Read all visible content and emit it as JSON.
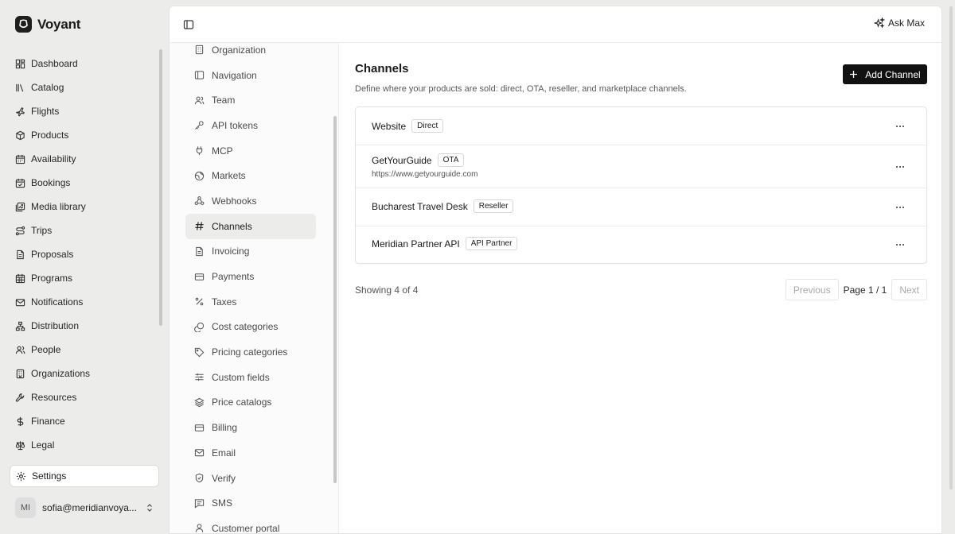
{
  "brand": {
    "name": "Voyant"
  },
  "sidebar": {
    "items": [
      {
        "label": "Dashboard",
        "icon": "dashboard-icon"
      },
      {
        "label": "Catalog",
        "icon": "catalog-icon"
      },
      {
        "label": "Flights",
        "icon": "plane-icon"
      },
      {
        "label": "Products",
        "icon": "package-icon"
      },
      {
        "label": "Availability",
        "icon": "calendar-icon"
      },
      {
        "label": "Bookings",
        "icon": "calendar-check-icon"
      },
      {
        "label": "Media library",
        "icon": "image-icon"
      },
      {
        "label": "Trips",
        "icon": "route-icon"
      },
      {
        "label": "Proposals",
        "icon": "document-icon"
      },
      {
        "label": "Programs",
        "icon": "calendar-grid-icon"
      },
      {
        "label": "Notifications",
        "icon": "mail-icon"
      },
      {
        "label": "Distribution",
        "icon": "network-icon"
      },
      {
        "label": "People",
        "icon": "users-icon"
      },
      {
        "label": "Organizations",
        "icon": "building-icon"
      },
      {
        "label": "Resources",
        "icon": "wrench-icon"
      },
      {
        "label": "Finance",
        "icon": "dollar-icon"
      },
      {
        "label": "Legal",
        "icon": "scales-icon"
      }
    ],
    "settings_label": "Settings",
    "user": {
      "initials": "MI",
      "email": "sofia@meridianvoya..."
    }
  },
  "topbar": {
    "ask_label": "Ask Max"
  },
  "settings_nav": {
    "items": [
      {
        "label": "Organization",
        "icon": "building-icon",
        "active": false
      },
      {
        "label": "Navigation",
        "icon": "sidebar-icon",
        "active": false
      },
      {
        "label": "Team",
        "icon": "users-icon",
        "active": false
      },
      {
        "label": "API tokens",
        "icon": "key-icon",
        "active": false
      },
      {
        "label": "MCP",
        "icon": "plug-icon",
        "active": false
      },
      {
        "label": "Markets",
        "icon": "globe-icon",
        "active": false
      },
      {
        "label": "Webhooks",
        "icon": "webhook-icon",
        "active": false
      },
      {
        "label": "Channels",
        "icon": "hash-icon",
        "active": true
      },
      {
        "label": "Invoicing",
        "icon": "document-icon",
        "active": false
      },
      {
        "label": "Payments",
        "icon": "credit-card-icon",
        "active": false
      },
      {
        "label": "Taxes",
        "icon": "percent-icon",
        "active": false
      },
      {
        "label": "Cost categories",
        "icon": "coins-icon",
        "active": false
      },
      {
        "label": "Pricing categories",
        "icon": "tag-icon",
        "active": false
      },
      {
        "label": "Custom fields",
        "icon": "sliders-icon",
        "active": false
      },
      {
        "label": "Price catalogs",
        "icon": "layers-icon",
        "active": false
      },
      {
        "label": "Billing",
        "icon": "credit-card-icon",
        "active": false
      },
      {
        "label": "Email",
        "icon": "mail-icon",
        "active": false
      },
      {
        "label": "Verify",
        "icon": "shield-check-icon",
        "active": false
      },
      {
        "label": "SMS",
        "icon": "message-icon",
        "active": false
      },
      {
        "label": "Customer portal",
        "icon": "user-icon",
        "active": false
      }
    ]
  },
  "page": {
    "title": "Channels",
    "description": "Define where your products are sold: direct, OTA, reseller, and marketplace channels.",
    "add_button": "Add Channel"
  },
  "channels": [
    {
      "name": "Website",
      "badge": "Direct",
      "url": ""
    },
    {
      "name": "GetYourGuide",
      "badge": "OTA",
      "url": "https://www.getyourguide.com"
    },
    {
      "name": "Bucharest Travel Desk",
      "badge": "Reseller",
      "url": ""
    },
    {
      "name": "Meridian Partner API",
      "badge": "API Partner",
      "url": ""
    }
  ],
  "pagination": {
    "showing": "Showing 4 of 4",
    "previous": "Previous",
    "page": "Page 1 / 1",
    "next": "Next"
  }
}
